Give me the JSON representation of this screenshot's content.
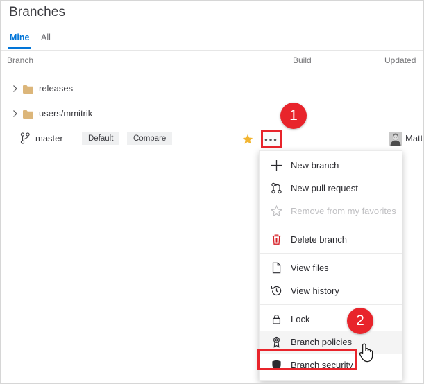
{
  "page": {
    "title": "Branches"
  },
  "pivots": [
    {
      "label": "Mine",
      "selected": true
    },
    {
      "label": "All",
      "selected": false
    }
  ],
  "columns": {
    "branch": "Branch",
    "build": "Build",
    "updated": "Updated"
  },
  "rows": [
    {
      "type": "folder",
      "label": "releases",
      "icon": "folder-icon",
      "chevron": "chevron-right-icon"
    },
    {
      "type": "folder",
      "label": "users/mmitrik",
      "icon": "folder-icon",
      "chevron": "chevron-right-icon"
    }
  ],
  "master_row": {
    "icon": "git-branch-icon",
    "label": "master",
    "tags": [
      {
        "label": "Default"
      },
      {
        "label": "Compare"
      }
    ],
    "favorite_icon": "star-filled-icon",
    "more_button": {
      "label": "•••",
      "icon": "ellipsis-icon"
    },
    "user": {
      "name": "Matt",
      "avatar": "user-avatar"
    }
  },
  "callouts": [
    {
      "number": "1",
      "target": "more-actions-button"
    },
    {
      "number": "2",
      "target": "branch-policies-menu-item"
    }
  ],
  "context_menu": {
    "items": [
      {
        "id": "new-branch",
        "label": "New branch",
        "icon": "plus-icon",
        "disabled": false,
        "separator_before": false,
        "highlighted": false
      },
      {
        "id": "new-pull-request",
        "label": "New pull request",
        "icon": "pull-request-icon",
        "disabled": false,
        "separator_before": false,
        "highlighted": false
      },
      {
        "id": "remove-from-favorites",
        "label": "Remove from my favorites",
        "icon": "star-outline-icon",
        "disabled": true,
        "separator_before": false,
        "highlighted": false
      },
      {
        "id": "delete-branch",
        "label": "Delete branch",
        "icon": "trash-icon",
        "disabled": false,
        "separator_before": true,
        "highlighted": false
      },
      {
        "id": "view-files",
        "label": "View files",
        "icon": "file-icon",
        "disabled": false,
        "separator_before": true,
        "highlighted": false
      },
      {
        "id": "view-history",
        "label": "View history",
        "icon": "history-icon",
        "disabled": false,
        "separator_before": false,
        "highlighted": false
      },
      {
        "id": "lock",
        "label": "Lock",
        "icon": "lock-icon",
        "disabled": false,
        "separator_before": true,
        "highlighted": false
      },
      {
        "id": "branch-policies",
        "label": "Branch policies",
        "icon": "ribbon-icon",
        "disabled": false,
        "separator_before": false,
        "highlighted": true
      },
      {
        "id": "branch-security",
        "label": "Branch security",
        "icon": "shield-icon",
        "disabled": false,
        "separator_before": false,
        "highlighted": false
      }
    ]
  },
  "colors": {
    "accent": "#0275d8",
    "callout_red": "#e8242b",
    "delete_red": "#d61f26",
    "folder_tan": "#dcb67a",
    "star_gold": "#f2b531",
    "text": "#3c3c41",
    "muted_text": "#767679",
    "disabled_text": "#bfbfc2"
  },
  "cursor": {
    "type": "pointing-hand"
  }
}
